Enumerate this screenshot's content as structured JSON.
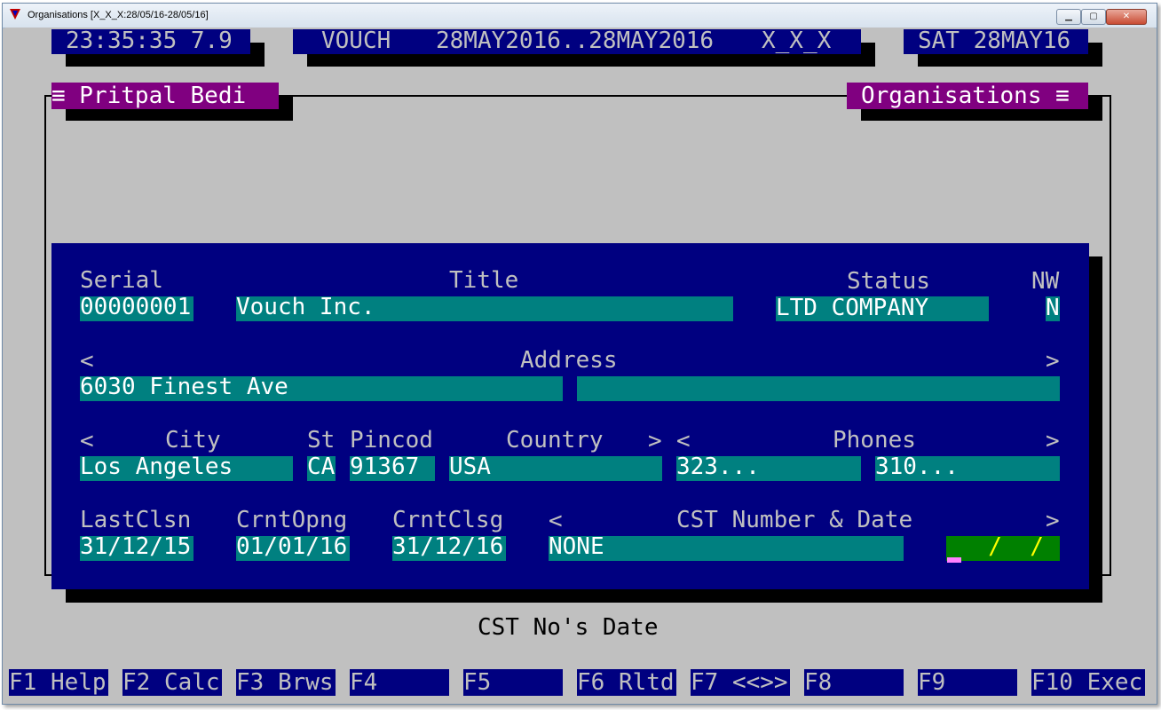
{
  "window": {
    "title": "Organisations [X_X_X:28/05/16-28/05/16]",
    "buttons": [
      "minimize",
      "maximize",
      "close"
    ]
  },
  "header": {
    "clock": "23:35:35 7.9",
    "vouch": "VOUCH",
    "range": "28MAY2016..28MAY2016",
    "company_code": "X_X_X",
    "date": "SAT 28MAY16"
  },
  "panel": {
    "user": "≡ Pritpal Bedi",
    "module": "Organisations ≡"
  },
  "form": {
    "labels": {
      "serial": "Serial",
      "title": "Title",
      "status": "Status",
      "nw": "NW",
      "address_left": "<",
      "address": "Address",
      "address_right": ">",
      "city_left": "<",
      "city": "City",
      "st": "St",
      "pincod": "Pincod",
      "country": "Country",
      "country_right": ">",
      "phones_left": "<",
      "phones": "Phones",
      "phones_right": ">",
      "lastclsn": "LastClsn",
      "crntopng": "CrntOpng",
      "crntclsg": "CrntClsg",
      "cst_left": "<",
      "cst": "CST Number & Date",
      "cst_right": ">"
    },
    "values": {
      "serial": "00000001",
      "title": "Vouch Inc.",
      "status": "LTD COMPANY",
      "nw": "N",
      "address1": "6030 Finest Ave",
      "address2": "",
      "city": "Los Angeles",
      "st": "CA",
      "pincod": "91367",
      "country": "USA",
      "phone1": "323...",
      "phone2": "310...",
      "lastclsn": "31/12/15",
      "crntopng": "01/01/16",
      "crntclsg": "31/12/16",
      "cst_number": "NONE",
      "cst_date": "  /  /"
    }
  },
  "status_message": "CST No's Date",
  "function_keys": [
    {
      "key": "F1",
      "label": "Help"
    },
    {
      "key": "F2",
      "label": "Calc"
    },
    {
      "key": "F3",
      "label": "Brws"
    },
    {
      "key": "F4",
      "label": ""
    },
    {
      "key": "F5",
      "label": ""
    },
    {
      "key": "F6",
      "label": "Rltd"
    },
    {
      "key": "F7",
      "label": "<<>>"
    },
    {
      "key": "F8",
      "label": ""
    },
    {
      "key": "F9",
      "label": ""
    },
    {
      "key": "F10",
      "label": "Exec"
    }
  ],
  "colors": {
    "background": "#c0c0c0",
    "navy": "#000080",
    "purple": "#800080",
    "teal": "#008080",
    "green_field": "#008000",
    "date_text": "#ffff00"
  }
}
